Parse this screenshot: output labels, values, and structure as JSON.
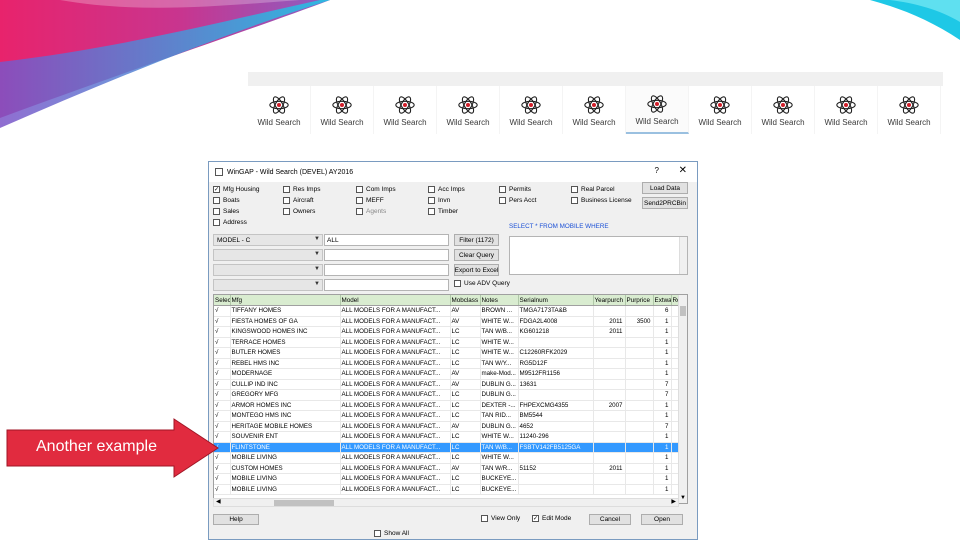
{
  "taskbar": {
    "items": [
      {
        "label": "Wild Search",
        "active": false
      },
      {
        "label": "Wild Search",
        "active": false
      },
      {
        "label": "Wild Search",
        "active": false
      },
      {
        "label": "Wild Search",
        "active": false
      },
      {
        "label": "Wild Search",
        "active": false
      },
      {
        "label": "Wild Search",
        "active": false
      },
      {
        "label": "Wild Search",
        "active": true
      },
      {
        "label": "Wild Search",
        "active": false
      },
      {
        "label": "Wild Search",
        "active": false
      },
      {
        "label": "Wild Search",
        "active": false
      },
      {
        "label": "Wild Search",
        "active": false
      }
    ]
  },
  "window": {
    "title": "WinGAP - Wild Search (DEVEL) AY2016",
    "help_glyph": "?",
    "close_glyph": "✕"
  },
  "checkboxes": {
    "mfg_housing": {
      "label": "Mfg Housing",
      "checked": true
    },
    "res_imps": {
      "label": "Res Imps"
    },
    "com_imps": {
      "label": "Com Imps"
    },
    "acc_imps": {
      "label": "Acc Imps"
    },
    "permits": {
      "label": "Permits"
    },
    "real_parcel": {
      "label": "Real Parcel"
    },
    "boats": {
      "label": "Boats"
    },
    "aircraft": {
      "label": "Aircraft"
    },
    "meff": {
      "label": "MEFF"
    },
    "invn": {
      "label": "Invn"
    },
    "pers_acct": {
      "label": "Pers Acct"
    },
    "business_license": {
      "label": "Business License"
    },
    "sales": {
      "label": "Sales"
    },
    "owners": {
      "label": "Owners"
    },
    "agents": {
      "label": "Agents"
    },
    "timber": {
      "label": "Timber"
    },
    "address": {
      "label": "Address"
    },
    "use_adv_query": {
      "label": "Use ADV Query"
    },
    "view_only": {
      "label": "View Only"
    },
    "edit_mode": {
      "label": "Edit Mode",
      "checked": true
    },
    "show_all": {
      "label": "Show All"
    }
  },
  "buttons": {
    "load_data": "Load Data",
    "send2prcbin": "Send2PRCBin",
    "filter": "Filter (1172)",
    "clear_query": "Clear Query",
    "export_to_excel": "Export to Excel",
    "help": "Help",
    "cancel": "Cancel",
    "open": "Open"
  },
  "query": {
    "field1": "MODEL - C",
    "value1": "ALL",
    "sql_label": "SELECT * FROM MOBILE WHERE"
  },
  "grid": {
    "columns": [
      "Selectw",
      "Mfg",
      "Model",
      "Mobclass",
      "Notes",
      "Serialnum",
      "Yearpurch",
      "Purprice",
      "Extwall",
      "Ro"
    ],
    "rows": [
      [
        "√",
        "TIFFANY HOMES",
        "ALL MODELS FOR A MANUFACT...",
        "AV",
        "BROWN ...",
        "TMGA7173TA&B",
        "",
        "",
        "6"
      ],
      [
        "√",
        "FIESTA HOMES OF GA",
        "ALL MODELS FOR A MANUFACT...",
        "AV",
        "WHITE W...",
        "FDGA2L4008",
        "2011",
        "3500",
        "1"
      ],
      [
        "√",
        "KINGSWOOD HOMES INC",
        "ALL MODELS FOR A MANUFACT...",
        "LC",
        "TAN W/B...",
        "KG601218",
        "2011",
        "",
        "1"
      ],
      [
        "√",
        "TERRACE HOMES",
        "ALL MODELS FOR A MANUFACT...",
        "LC",
        "WHITE W...",
        "",
        "",
        "",
        "1"
      ],
      [
        "√",
        "BUTLER HOMES",
        "ALL MODELS FOR A MANUFACT...",
        "LC",
        "WHITE W...",
        "C12260RFK2029",
        "",
        "",
        "1"
      ],
      [
        "√",
        "REBEL HMS INC",
        "ALL MODELS FOR A MANUFACT...",
        "LC",
        "TAN W/Y...",
        "RG5D12F",
        "",
        "",
        "1"
      ],
      [
        "√",
        "MODERNAGE",
        "ALL MODELS FOR A MANUFACT...",
        "AV",
        "make-Mod...",
        "M9512FR1156",
        "",
        "",
        "1"
      ],
      [
        "√",
        "CULLIP IND INC",
        "ALL MODELS FOR A MANUFACT...",
        "AV",
        "DUBLIN G...",
        "13631",
        "",
        "",
        "7"
      ],
      [
        "√",
        "GREGORY MFG",
        "ALL MODELS FOR A MANUFACT...",
        "LC",
        "DUBLIN G...",
        "",
        "",
        "",
        "7"
      ],
      [
        "√",
        "ARMOR HOMES INC",
        "ALL MODELS FOR A MANUFACT...",
        "LC",
        "DEXTER -...",
        "FHPEXCMG4355",
        "2007",
        "",
        "1"
      ],
      [
        "√",
        "MONTEGO HMS INC",
        "ALL MODELS FOR A MANUFACT...",
        "LC",
        "TAN RID...",
        "BM5544",
        "",
        "",
        "1"
      ],
      [
        "√",
        "HERITAGE MOBILE HOMES",
        "ALL MODELS FOR A MANUFACT...",
        "AV",
        "DUBLIN G...",
        "4652",
        "",
        "",
        "7"
      ],
      [
        "√",
        "SOUVENIR ENT",
        "ALL MODELS FOR A MANUFACT...",
        "LC",
        "WHITE W...",
        "11240-296",
        "",
        "",
        "1"
      ],
      [
        "√",
        "FLINTSTONE",
        "ALL MODELS FOR A MANUFACT...",
        "LC",
        "TAN W/B...",
        "FSBTV142FB5125GA",
        "",
        "",
        "1"
      ],
      [
        "√",
        "MOBILE LIVING",
        "ALL MODELS FOR A MANUFACT...",
        "LC",
        "WHITE W...",
        "",
        "",
        "",
        "1"
      ],
      [
        "√",
        "CUSTOM HOMES",
        "ALL MODELS FOR A MANUFACT...",
        "AV",
        "TAN W/R...",
        "51152",
        "2011",
        "",
        "1"
      ],
      [
        "√",
        "MOBILE LIVING",
        "ALL MODELS FOR A MANUFACT...",
        "LC",
        "BUCKEYE...",
        "",
        "",
        "",
        "1"
      ],
      [
        "√",
        "MOBILE LIVING",
        "ALL MODELS FOR A MANUFACT...",
        "LC",
        "BUCKEYE...",
        "",
        "",
        "",
        "1"
      ]
    ],
    "selected_row": 13
  },
  "annotation": {
    "text": "Another example"
  },
  "colors": {
    "swoosh_pink": "#e8236c",
    "swoosh_cyan": "#1ec8e6",
    "callout_red": "#e12b3f",
    "header_green": "#d9ecd0",
    "selection_blue": "#3399ff",
    "sql_blue": "#1a4fd6"
  }
}
